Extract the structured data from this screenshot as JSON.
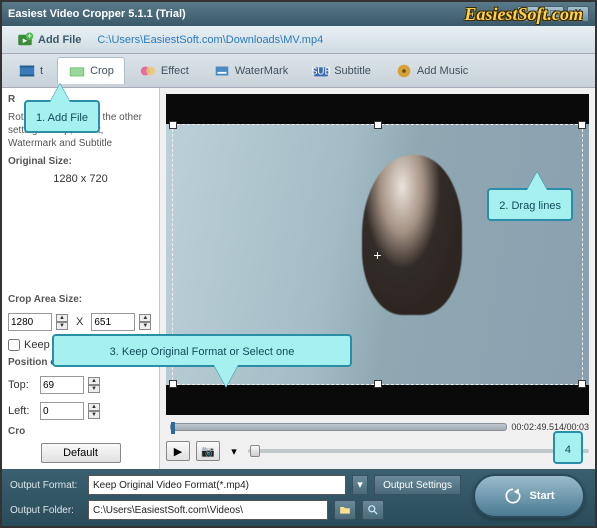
{
  "window": {
    "title": "Easiest Video Cropper 5.1.1 (Trial)"
  },
  "watermark": "EasiestSoft.com",
  "addfile": {
    "label": "Add File",
    "path": "C:\\Users\\EasiestSoft.com\\Downloads\\MV.mp4"
  },
  "tabs": [
    {
      "label": "t"
    },
    {
      "label": "Crop"
    },
    {
      "label": "Effect"
    },
    {
      "label": "WaterMark"
    },
    {
      "label": "Subtitle"
    },
    {
      "label": "Add Music"
    }
  ],
  "left": {
    "rotation_hint": "Rotation will reset all the other settings: Crop, Effect, Watermark and Subtitle",
    "orig_label": "Original Size:",
    "orig_value": "1280 x 720",
    "croparea_label": "Crop Area Size:",
    "crop_w": "1280",
    "crop_h": "651",
    "keep_aspect": "Keep Aspect Ratio",
    "pos_label": "Position of Crop Area:",
    "top_label": "Top:",
    "top_val": "69",
    "left_label": "Left:",
    "left_val": "0",
    "cro_prefix": "Cro",
    "default_btn": "Default"
  },
  "timeline": {
    "time": "00:02:49.514/00:03"
  },
  "bottom": {
    "format_label": "Output Format:",
    "format_value": "Keep Original Video Format(*.mp4)",
    "settings_btn": "Output Settings",
    "folder_label": "Output Folder:",
    "folder_value": "C:\\Users\\EasiestSoft.com\\Videos\\",
    "start": "Start"
  },
  "callouts": {
    "c1": "1. Add File",
    "c2": "2. Drag lines",
    "c3": "3. Keep Original Format or Select one",
    "c4": "4"
  }
}
